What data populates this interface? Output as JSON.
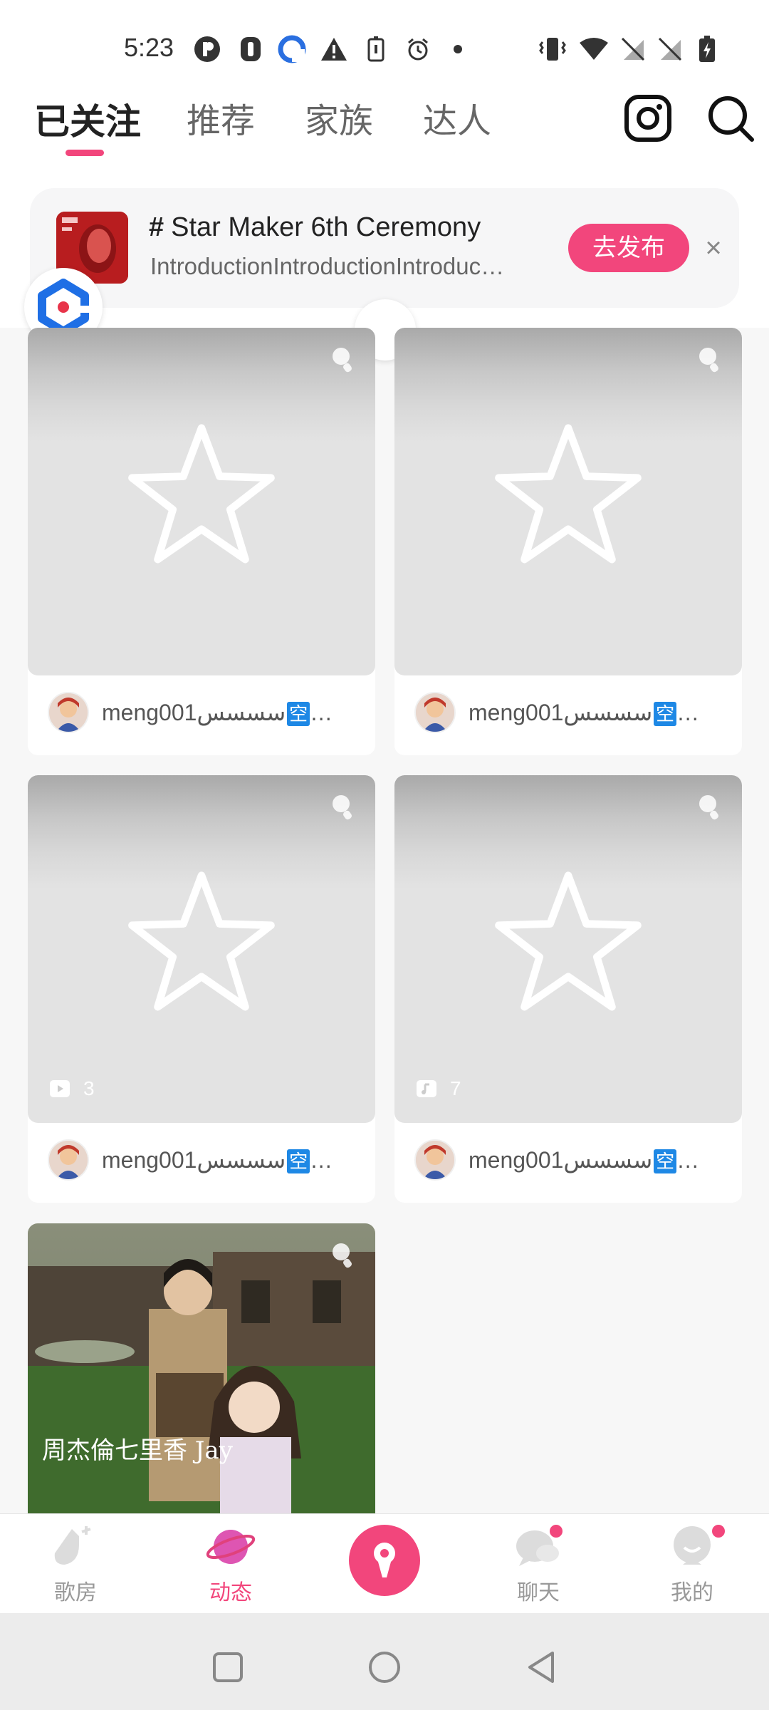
{
  "status_bar": {
    "time": "5:23",
    "icons": [
      "app-p-icon",
      "app-shield-icon",
      "app-blue-icon",
      "warning-icon",
      "battery-saver-icon",
      "alarm-icon",
      "dot-icon",
      "vibrate-icon",
      "wifi-icon",
      "no-sim-icon",
      "no-sim-icon",
      "battery-charging-icon"
    ]
  },
  "top_nav": {
    "tabs": [
      {
        "label": "已关注",
        "active": true
      },
      {
        "label": "推荐",
        "active": false
      },
      {
        "label": "家族",
        "active": false
      },
      {
        "label": "达人",
        "active": false
      }
    ],
    "icons": [
      "instagram-icon",
      "search-icon"
    ]
  },
  "banner": {
    "hash": "#",
    "title": "Star Maker 6th Ceremony",
    "description": "IntroductionIntroductionIntroduc…",
    "button": "去发布",
    "close": "×"
  },
  "feed": {
    "cards": [
      {
        "user": "meng001",
        "suffix": "سسسس",
        "tag": "空",
        "ellipsis": "…",
        "count": ""
      },
      {
        "user": "meng001",
        "suffix": "سسسس",
        "tag": "空",
        "ellipsis": "…",
        "count": ""
      },
      {
        "user": "meng001",
        "suffix": "سسسس",
        "tag": "空",
        "ellipsis": "…",
        "count": "3"
      },
      {
        "user": "meng001",
        "suffix": "سسسس",
        "tag": "空",
        "ellipsis": "…",
        "count": "7"
      }
    ],
    "photo_caption": "周杰倫七里香 Jay"
  },
  "bottom_nav": {
    "items": [
      {
        "label": "歌房",
        "active": false
      },
      {
        "label": "动态",
        "active": true
      },
      {
        "label": "",
        "active": false
      },
      {
        "label": "聊天",
        "active": false
      },
      {
        "label": "我的",
        "active": false
      }
    ]
  },
  "colors": {
    "accent": "#f2467c",
    "tag_blue": "#1e88e5"
  }
}
